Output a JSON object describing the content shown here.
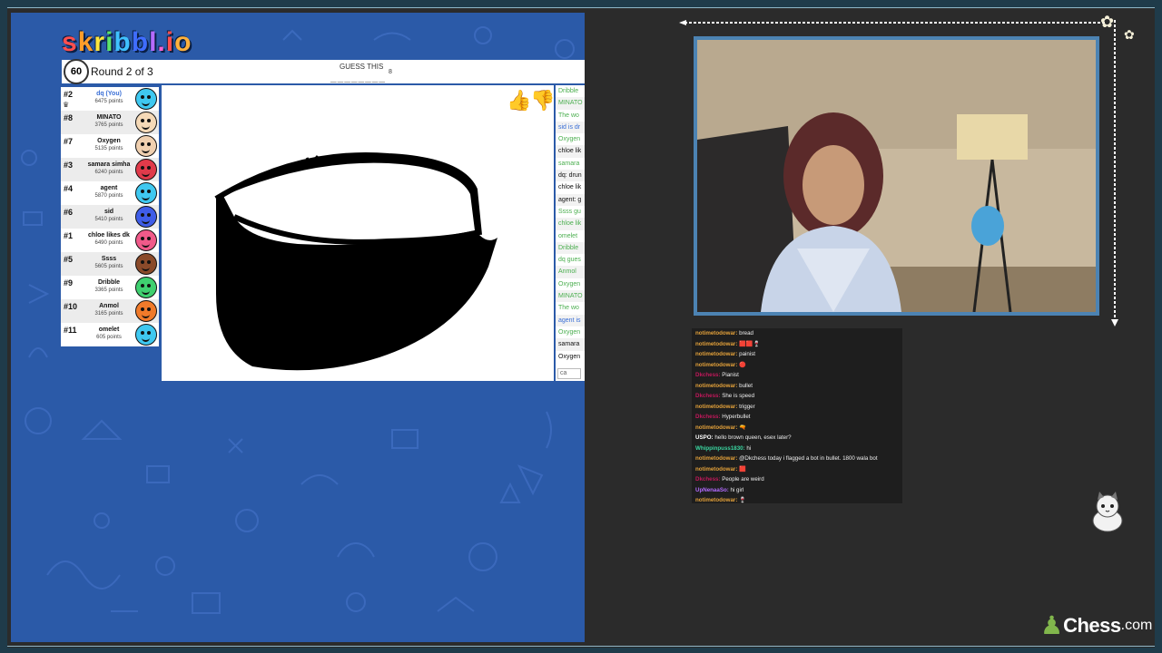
{
  "game": {
    "logo_letters": [
      "s",
      "k",
      "r",
      "i",
      "b",
      "b",
      "l",
      ".",
      "i",
      "o"
    ],
    "logo_colors": [
      "#ff4f4f",
      "#ff9d2a",
      "#ffe63d",
      "#5ce36a",
      "#3fc1ff",
      "#3f6dff",
      "#b66bff",
      "#ff5fd0",
      "#ff4f4f",
      "#ffb13d"
    ],
    "timer": "60",
    "round": "Round 2 of 3",
    "guess_label": "GUESS THIS",
    "guess_blanks": "________",
    "guess_count": "8",
    "players": [
      {
        "rank": "#2",
        "name": "dq (You)",
        "points": "6475 points",
        "color": "#3fc8f0",
        "me": true
      },
      {
        "rank": "#8",
        "name": "MINATO",
        "points": "3765 points",
        "color": "#f5d9b7"
      },
      {
        "rank": "#7",
        "name": "Oxygen",
        "points": "5135 points",
        "color": "#f0d0b0"
      },
      {
        "rank": "#3",
        "name": "samara simha",
        "points": "6240 points",
        "color": "#e03a4a"
      },
      {
        "rank": "#4",
        "name": "agent",
        "points": "5870 points",
        "color": "#3fc8f0"
      },
      {
        "rank": "#6",
        "name": "sid",
        "points": "5410 points",
        "color": "#3f5de8"
      },
      {
        "rank": "#1",
        "name": "chloe likes dk",
        "points": "6490 points",
        "color": "#f05a8a"
      },
      {
        "rank": "#5",
        "name": "Ssss",
        "points": "5605 points",
        "color": "#8a4a2a"
      },
      {
        "rank": "#9",
        "name": "Dribble",
        "points": "3365 points",
        "color": "#3fd070"
      },
      {
        "rank": "#10",
        "name": "Anmol",
        "points": "3165 points",
        "color": "#f07a2a"
      },
      {
        "rank": "#11",
        "name": "omelet",
        "points": "605 points",
        "color": "#3fc8f0"
      }
    ],
    "chat": [
      {
        "text": "Dribble",
        "color": "#4caf50"
      },
      {
        "text": "MINATO",
        "color": "#4caf50"
      },
      {
        "text": "The wo",
        "color": "#4caf50"
      },
      {
        "text": "sid is dr",
        "color": "#3a6fd6"
      },
      {
        "text": "Oxygen",
        "color": "#4caf50"
      },
      {
        "text": "chloe lik",
        "color": "#111"
      },
      {
        "text": "samara",
        "color": "#4caf50"
      },
      {
        "text": "dq: drun",
        "color": "#111"
      },
      {
        "text": "chloe lik",
        "color": "#111"
      },
      {
        "text": "agent: g",
        "color": "#111"
      },
      {
        "text": "Ssss gu",
        "color": "#4caf50"
      },
      {
        "text": "chloe lik",
        "color": "#4caf50"
      },
      {
        "text": "omelet",
        "color": "#4caf50"
      },
      {
        "text": "Dribble",
        "color": "#4caf50"
      },
      {
        "text": "dq gues",
        "color": "#4caf50"
      },
      {
        "text": "Anmol",
        "color": "#4caf50"
      },
      {
        "text": "Oxygen",
        "color": "#4caf50"
      },
      {
        "text": "MINATO",
        "color": "#4caf50"
      },
      {
        "text": "The wo",
        "color": "#4caf50"
      },
      {
        "text": "agent is",
        "color": "#3a6fd6"
      },
      {
        "text": "Oxygen",
        "color": "#4caf50"
      },
      {
        "text": "samara",
        "color": "#111"
      },
      {
        "text": "Oxygen",
        "color": "#111"
      }
    ],
    "chat_input_value": "ca"
  },
  "twitch_chat": [
    {
      "user": "notimetodowar:",
      "color": "#e3a13a",
      "msg": "bread"
    },
    {
      "user": "notimetodowar:",
      "color": "#e3a13a",
      "msg": "🟥🟥🍷"
    },
    {
      "user": "notimetodowar:",
      "color": "#e3a13a",
      "msg": "painist"
    },
    {
      "user": "notimetodowar:",
      "color": "#e3a13a",
      "msg": "🔴"
    },
    {
      "user": "Dkchess:",
      "color": "#c2185b",
      "msg": "Pianist"
    },
    {
      "user": "notimetodowar:",
      "color": "#e3a13a",
      "msg": "bullet"
    },
    {
      "user": "Dkchess:",
      "color": "#c2185b",
      "msg": "She is speed"
    },
    {
      "user": "notimetodowar:",
      "color": "#e3a13a",
      "msg": "trigger"
    },
    {
      "user": "Dkchess:",
      "color": "#c2185b",
      "msg": "Hyperbullet"
    },
    {
      "user": "notimetodowar:",
      "color": "#e3a13a",
      "msg": "🔫"
    },
    {
      "user": "USPO:",
      "color": "#ffffff",
      "msg": "hello brown queen, esex later?"
    },
    {
      "user": "Whippinpuss1830:",
      "color": "#3ad6a0",
      "msg": "hi"
    },
    {
      "user": "notimetodowar:",
      "color": "#e3a13a",
      "msg": "@Dkchess today i flagged a bot in bullet. 1800 wala bot"
    },
    {
      "user": "notimetodowar:",
      "color": "#e3a13a",
      "msg": "🟥"
    },
    {
      "user": "Dkchess:",
      "color": "#c2185b",
      "msg": "People are weird"
    },
    {
      "user": "UpNenaaSo:",
      "color": "#b36bff",
      "msg": "hi girl"
    },
    {
      "user": "notimetodowar:",
      "color": "#e3a13a",
      "msg": "🍷"
    }
  ],
  "brand": {
    "chess_name": "Chess",
    "chess_suffix": ".com",
    "chess_green": "#81b64c",
    "pawn": "♟"
  },
  "icons": {
    "thumb_up": "👍",
    "thumb_down": "👎",
    "flower": "✿",
    "crown": "♛"
  }
}
